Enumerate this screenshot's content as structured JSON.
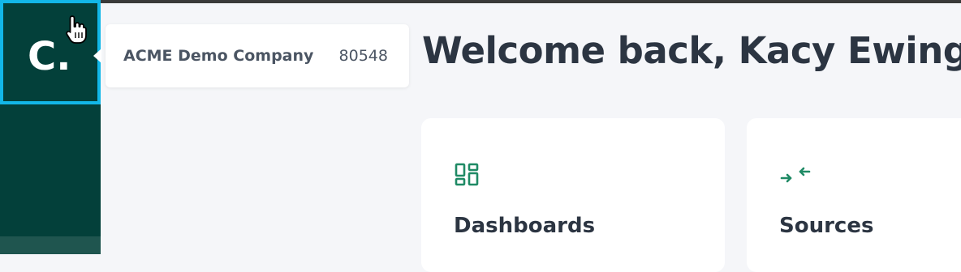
{
  "company": {
    "name": "ACME Demo Company",
    "id": "80548"
  },
  "header": {
    "welcome": "Welcome back, Kacy Ewing."
  },
  "logo": {
    "text": "C."
  },
  "cards": [
    {
      "title": "Dashboards",
      "icon": "dashboard-grid-icon"
    },
    {
      "title": "Sources",
      "icon": "arrows-inward-icon"
    }
  ],
  "colors": {
    "sidebar": "#03403a",
    "focus_ring": "#12b7e8",
    "accent_green": "#1f8a65",
    "text_dark": "#2c3542",
    "background": "#f5f6f9"
  }
}
